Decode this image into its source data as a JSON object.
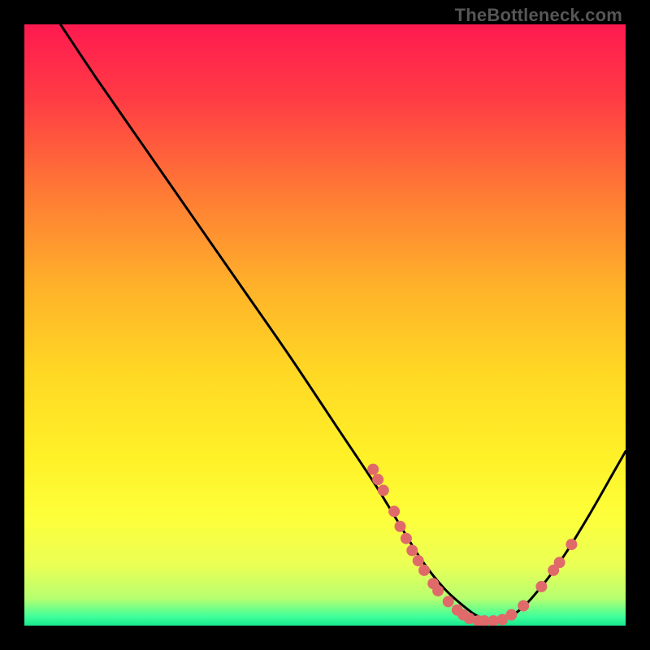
{
  "watermark": "TheBottleneck.com",
  "chart_data": {
    "type": "line",
    "title": "",
    "xlabel": "",
    "ylabel": "",
    "xlim": [
      0,
      100
    ],
    "ylim": [
      0,
      100
    ],
    "grid": false,
    "legend": false,
    "background_gradient": {
      "stops": [
        {
          "offset": 0.0,
          "color": "#ff1a50"
        },
        {
          "offset": 0.12,
          "color": "#ff3a45"
        },
        {
          "offset": 0.28,
          "color": "#ff7a35"
        },
        {
          "offset": 0.44,
          "color": "#ffb329"
        },
        {
          "offset": 0.58,
          "color": "#ffd824"
        },
        {
          "offset": 0.72,
          "color": "#fff128"
        },
        {
          "offset": 0.82,
          "color": "#fdff3a"
        },
        {
          "offset": 0.9,
          "color": "#eaff55"
        },
        {
          "offset": 0.955,
          "color": "#b6ff70"
        },
        {
          "offset": 0.985,
          "color": "#3fff9a"
        },
        {
          "offset": 1.0,
          "color": "#18e88f"
        }
      ]
    },
    "series": [
      {
        "name": "bottleneck-curve",
        "color": "#000000",
        "x": [
          6,
          12,
          20,
          28,
          36,
          44,
          52,
          58,
          62,
          66,
          70,
          74,
          76,
          78,
          82,
          86,
          90,
          94,
          98,
          100
        ],
        "y": [
          100,
          91,
          79.5,
          68,
          56.5,
          45,
          33,
          24,
          17.5,
          11,
          6,
          2.5,
          1.3,
          0.7,
          2.3,
          6.5,
          12,
          18.5,
          25.5,
          29
        ]
      }
    ],
    "points": {
      "name": "sample-points",
      "color": "#e06a6a",
      "radius_px": 7,
      "data": [
        {
          "x": 58.0,
          "y": 26.0
        },
        {
          "x": 58.8,
          "y": 24.3
        },
        {
          "x": 59.7,
          "y": 22.5
        },
        {
          "x": 61.5,
          "y": 19.0
        },
        {
          "x": 62.5,
          "y": 16.5
        },
        {
          "x": 63.5,
          "y": 14.5
        },
        {
          "x": 64.5,
          "y": 12.5
        },
        {
          "x": 65.5,
          "y": 10.8
        },
        {
          "x": 66.5,
          "y": 9.2
        },
        {
          "x": 68.0,
          "y": 7.0
        },
        {
          "x": 68.8,
          "y": 5.8
        },
        {
          "x": 70.5,
          "y": 4.0
        },
        {
          "x": 72.0,
          "y": 2.6
        },
        {
          "x": 73.0,
          "y": 1.8
        },
        {
          "x": 74.0,
          "y": 1.2
        },
        {
          "x": 75.5,
          "y": 0.8
        },
        {
          "x": 76.5,
          "y": 0.8
        },
        {
          "x": 78.0,
          "y": 0.8
        },
        {
          "x": 79.5,
          "y": 1.0
        },
        {
          "x": 81.0,
          "y": 1.8
        },
        {
          "x": 83.0,
          "y": 3.3
        },
        {
          "x": 86.0,
          "y": 6.5
        },
        {
          "x": 88.0,
          "y": 9.2
        },
        {
          "x": 89.0,
          "y": 10.5
        },
        {
          "x": 91.0,
          "y": 13.5
        }
      ]
    }
  }
}
